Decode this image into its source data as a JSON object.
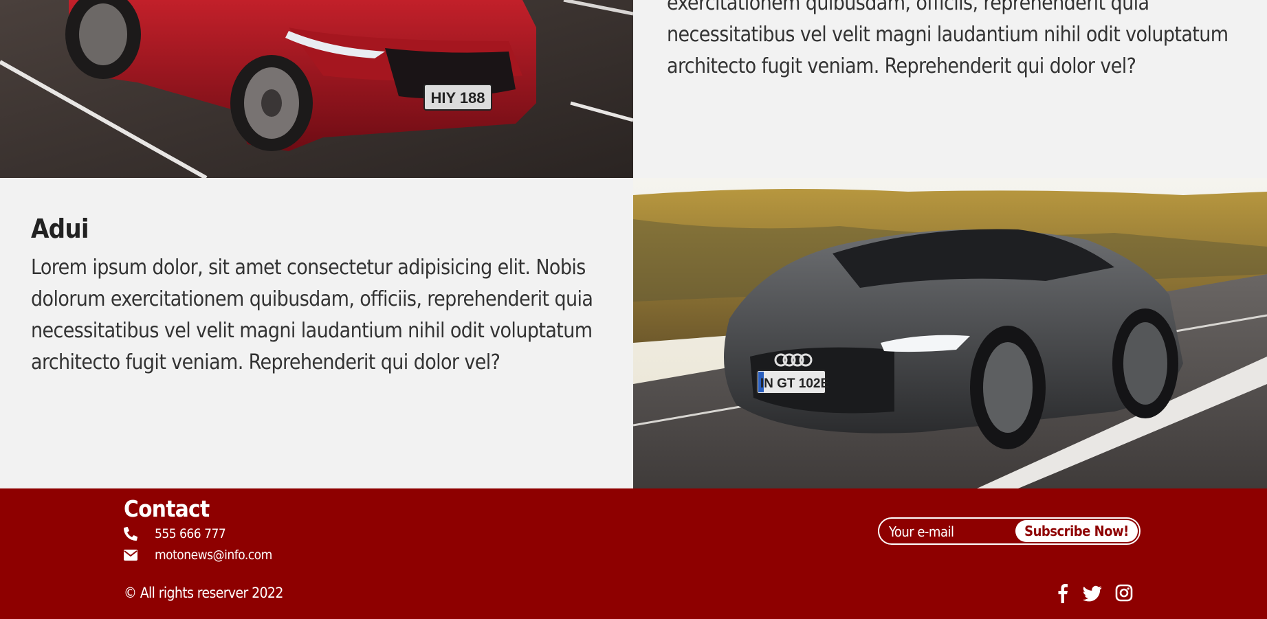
{
  "section_top": {
    "paragraph_partial": "exercitationem quibusdam, officiis, reprehenderit quia necessitatibus vel velit magni laudantium nihil odit voluptatum architecto fugit veniam. Reprehenderit qui dolor vel?",
    "car_image": "red-ford-mustang-mach-e-photo"
  },
  "section_adui": {
    "title": "Adui",
    "paragraph": "Lorem ipsum dolor, sit amet consectetur adipisicing elit. Nobis dolorum exercitationem quibusdam, officiis, reprehenderit quia necessitatibus vel velit magni laudantium nihil odit voluptatum architecto fugit veniam. Reprehenderit qui dolor vel?",
    "car_image": "grey-audi-e-tron-gt-photo"
  },
  "footer": {
    "contact_title": "Contact",
    "phone": "555 666 777",
    "email": "motonews@info.com",
    "copyright": "© All rights reserver 2022",
    "email_placeholder": "Your e-mail",
    "subscribe_label": "Subscribe Now!",
    "social": [
      "facebook-icon",
      "twitter-icon",
      "instagram-icon"
    ],
    "bg_color": "#8e0000"
  },
  "colors": {
    "background": "#f2f2f2",
    "text": "#333333",
    "accent": "#8e0000"
  }
}
